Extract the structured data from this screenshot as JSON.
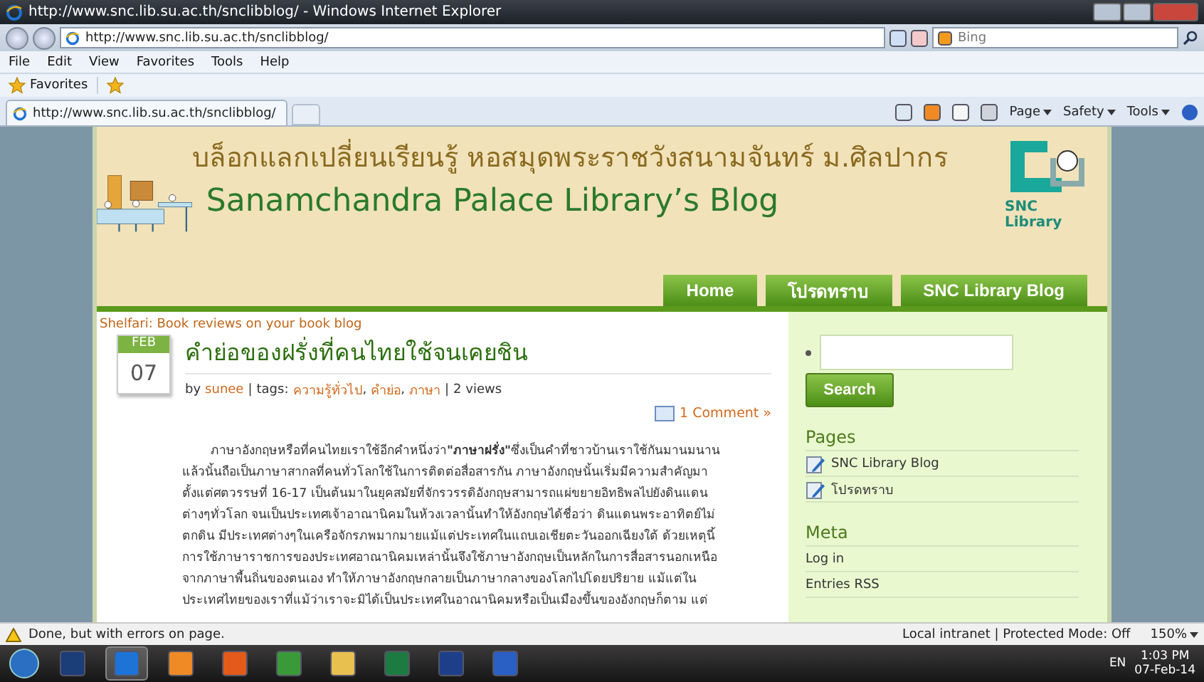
{
  "window": {
    "title": "http://www.snc.lib.su.ac.th/snclibblog/ - Windows Internet Explorer"
  },
  "address": {
    "url": "http://www.snc.lib.su.ac.th/snclibblog/",
    "search_placeholder": "Bing"
  },
  "menu": [
    "File",
    "Edit",
    "View",
    "Favorites",
    "Tools",
    "Help"
  ],
  "favorites_bar": {
    "label": "Favorites"
  },
  "tab": {
    "title": "http://www.snc.lib.su.ac.th/snclibblog/"
  },
  "command_bar": [
    "Page",
    "Safety",
    "Tools"
  ],
  "header": {
    "thai_title": "บล็อกแลกเปลี่ยนเรียนรู้ หอสมุดพระราชวังสนามจันทร์ ม.ศิลปากร",
    "title": "Sanamchandra Palace Library’s Blog",
    "logo_text": "SNC Library"
  },
  "nav": [
    "Home",
    "โปรดทราบ",
    "SNC Library Blog"
  ],
  "shelfari_link": "Shelfari: Book reviews on your book blog",
  "post": {
    "month": "FEB",
    "day": "07",
    "title": "คำย่อของฝรั่งที่คนไทยใช้จนเคยชิน",
    "by": "by",
    "author": "sunee",
    "tags_label": "tags:",
    "tags": [
      "ความรู้ทั่วไป",
      "คำย่อ",
      "ภาษา"
    ],
    "tag_separator": ",",
    "meta_separator": "|",
    "views": "2 views",
    "comments": "1 Comment »",
    "body_lines": [
      "ภาษาอังกฤษหรือที่คนไทยเราใช้อีกคำหนึ่งว่า**\"ภาษาฝรั่ง\"**ซึ่งเป็นคำที่ชาวบ้านเราใช้กันมานมนาน",
      "แล้วนั้นถือเป็นภาษาสากลที่คนทั่วโลกใช้ในการติดต่อสื่อสารกัน ภาษาอังกฤษนั้นเริ่มมีความสำคัญมา",
      "ตั้งแต่ศตวรรษที่ 16-17 เป็นต้นมาในยุคสมัยที่จักรวรรดิอังกฤษสามารถแผ่ขยายอิทธิพลไปยังดินแดน",
      "ต่างๆทั่วโลก จนเป็นประเทศเจ้าอาณานิคมในห้วงเวลานั้นทำให้อังกฤษได้ชื่อว่า ดินแดนพระอาทิตย์ไม่",
      "ตกดิน มีประเทศต่างๆในเครือจักรภพมากมายแม้แต่ประเทศในแถบเอเชียตะวันออกเฉียงใต้ ด้วยเหตุนี้",
      "การใช้ภาษาราชการของประเทศอาณานิคมเหล่านั้นจึงใช้ภาษาอังกฤษเป็นหลักในการสื่อสารนอกเหนือ",
      "จากภาษาพื้นถิ่นของตนเอง ทำให้ภาษาอังกฤษกลายเป็นภาษากลางของโลกไปโดยปริยาย แม้แต่ใน",
      "ประเทศไทยของเราที่แม้ว่าเราจะมิได้เป็นประเทศในอาณานิคมหรือเป็นเมืองขึ้นของอังกฤษก็ตาม แต่"
    ]
  },
  "sidebar": {
    "search_button": "Search",
    "pages_heading": "Pages",
    "pages": [
      "SNC Library Blog",
      "โปรดทราบ"
    ],
    "meta_heading": "Meta",
    "meta": [
      "Log in",
      "Entries RSS"
    ]
  },
  "status_bar": {
    "text": "Done, but with errors on page.",
    "zone": "Local intranet | Protected Mode: Off",
    "zoom": "150%"
  },
  "taskbar": {
    "language": "EN",
    "time": "1:03 PM",
    "date": "07-Feb-14"
  }
}
